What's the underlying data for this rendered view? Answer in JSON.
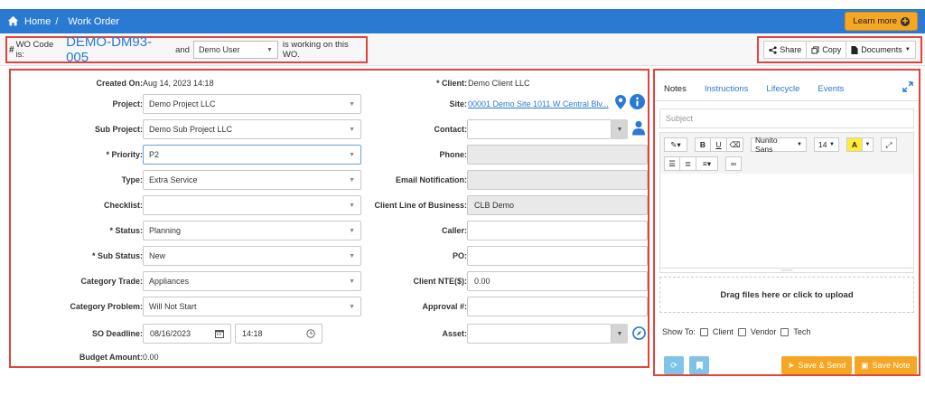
{
  "breadcrumb": {
    "home": "Home",
    "separator": "/",
    "current": "Work Order"
  },
  "learn_more": "Learn more",
  "wo": {
    "hash": "#",
    "label": "WO Code is:",
    "code": "DEMO-DM93-005",
    "and": "and",
    "user": "Demo User",
    "tail": "is working on this WO."
  },
  "actions": {
    "share": "Share",
    "copy": "Copy",
    "documents": "Documents"
  },
  "form": {
    "created_on_label": "Created On:",
    "created_on": "Aug 14, 2023 14:18",
    "project_label": "Project:",
    "project": "Demo Project LLC",
    "sub_project_label": "Sub Project:",
    "sub_project": "Demo Sub Project LLC",
    "priority_label": "* Priority:",
    "priority": "P2",
    "type_label": "Type:",
    "type": "Extra Service",
    "checklist_label": "Checklist:",
    "checklist": "",
    "status_label": "* Status:",
    "status": "Planning",
    "sub_status_label": "* Sub Status:",
    "sub_status": "New",
    "category_trade_label": "Category Trade:",
    "category_trade": "Appliances",
    "category_problem_label": "Category Problem:",
    "category_problem": "Will Not Start",
    "so_deadline_label": "SO Deadline:",
    "so_deadline_date": "08/16/2023",
    "so_deadline_time": "14:18",
    "budget_label": "Budget Amount:",
    "budget": "0.00",
    "client_label": "* Client:",
    "client": "Demo Client LLC",
    "site_label": "Site:",
    "site": "00001 Demo Site 1011 W Central Blv...",
    "contact_label": "Contact:",
    "contact": "",
    "phone_label": "Phone:",
    "phone": "",
    "email_label": "Email Notification:",
    "email": "",
    "clob_label": "Client Line of Business:",
    "clob": "CLB Demo",
    "caller_label": "Caller:",
    "caller": "",
    "po_label": "PO:",
    "po": "",
    "nte_label": "Client NTE($):",
    "nte": "0.00",
    "approval_label": "Approval #:",
    "approval": "",
    "asset_label": "Asset:",
    "asset": ""
  },
  "notes": {
    "tabs": [
      "Notes",
      "Instructions",
      "Lifecycle",
      "Events"
    ],
    "subject_placeholder": "Subject",
    "toolbar": {
      "bold": "B",
      "underline": "U",
      "font": "Nunito Sans",
      "size": "14",
      "highlight": "A"
    },
    "drop_text": "Drag files here or click to upload",
    "show_to": "Show To:",
    "show_client": "Client",
    "show_vendor": "Vendor",
    "show_tech": "Tech",
    "save_send": "Save & Send",
    "save_note": "Save Note"
  },
  "colors": {
    "primary": "#2a7ad4",
    "accent": "#f5a623",
    "highlight_border": "#e0443b"
  }
}
